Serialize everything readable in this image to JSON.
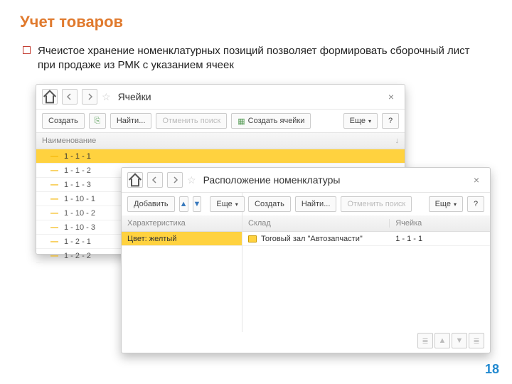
{
  "slide": {
    "title": "Учет товаров",
    "bullet": "Ячеистое хранение номенклатурных позиций позволяет формировать сборочный лист при продаже из РМК с указанием ячеек",
    "page_number": "18"
  },
  "win1": {
    "title": "Ячейки",
    "toolbar": {
      "create": "Создать",
      "find": "Найти...",
      "cancel_find": "Отменить поиск",
      "create_cells": "Создать ячейки",
      "more": "Еще",
      "help": "?"
    },
    "grid": {
      "header": "Наименование",
      "rows": [
        "1 - 1 - 1",
        "1 - 1 - 2",
        "1 - 1 - 3",
        "1 - 10 - 1",
        "1 - 10 - 2",
        "1 - 10 - 3",
        "1 - 2 - 1",
        "1 - 2 - 2"
      ],
      "selected_index": 0
    }
  },
  "win2": {
    "title": "Расположение номенклатуры",
    "left": {
      "add": "Добавить",
      "more": "Еще",
      "header": "Характеристика",
      "row": "Цвет: желтый"
    },
    "right": {
      "create": "Создать",
      "find": "Найти...",
      "cancel_find": "Отменить поиск",
      "more": "Еще",
      "help": "?",
      "col1": "Склад",
      "col2": "Ячейка",
      "val1": "Тоговый зал \"Автозапчасти\"",
      "val2": "1 - 1 - 1"
    }
  }
}
